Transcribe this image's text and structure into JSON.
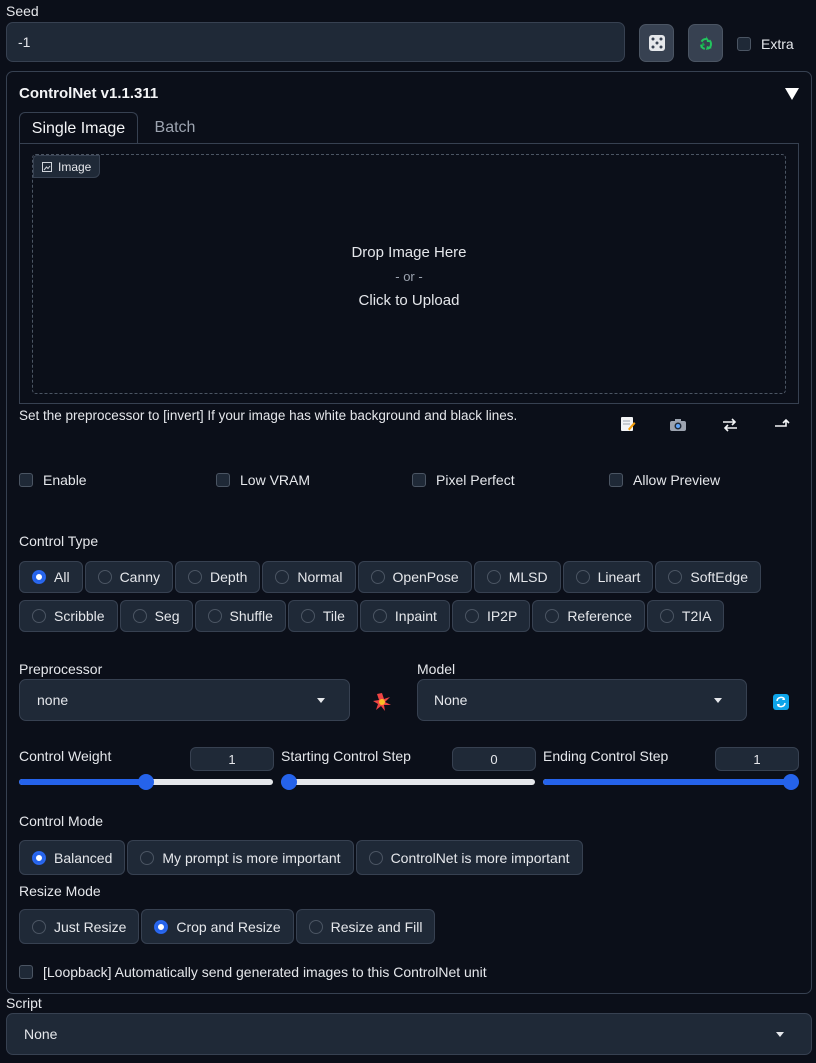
{
  "seed": {
    "label": "Seed",
    "value": "-1",
    "extra_label": "Extra"
  },
  "controlnet": {
    "title": "ControlNet v1.1.311",
    "tabs": [
      {
        "label": "Single Image",
        "active": true
      },
      {
        "label": "Batch",
        "active": false
      }
    ],
    "image_tag": "Image",
    "drop_text": "Drop Image Here",
    "or_text": "- or -",
    "upload_text": "Click to Upload",
    "hint": "Set the preprocessor to [invert] If your image has white background and black lines.",
    "checkboxes": [
      "Enable",
      "Low VRAM",
      "Pixel Perfect",
      "Allow Preview"
    ],
    "control_type": {
      "label": "Control Type",
      "selected": "All",
      "row1": [
        "All",
        "Canny",
        "Depth",
        "Normal",
        "OpenPose",
        "MLSD",
        "Lineart",
        "SoftEdge"
      ],
      "row2": [
        "Scribble",
        "Seg",
        "Shuffle",
        "Tile",
        "Inpaint",
        "IP2P",
        "Reference",
        "T2IA"
      ]
    },
    "preprocessor": {
      "label": "Preprocessor",
      "value": "none"
    },
    "model": {
      "label": "Model",
      "value": "None"
    },
    "control_weight": {
      "label": "Control Weight",
      "value": "1",
      "fraction": 0.5
    },
    "starting_step": {
      "label": "Starting Control Step",
      "value": "0",
      "fraction": 0.0
    },
    "ending_step": {
      "label": "Ending Control Step",
      "value": "1",
      "fraction": 1.0
    },
    "control_mode": {
      "label": "Control Mode",
      "selected": "Balanced",
      "options": [
        "Balanced",
        "My prompt is more important",
        "ControlNet is more important"
      ]
    },
    "resize_mode": {
      "label": "Resize Mode",
      "selected": "Crop and Resize",
      "options": [
        "Just Resize",
        "Crop and Resize",
        "Resize and Fill"
      ]
    },
    "loopback_label": "[Loopback] Automatically send generated images to this ControlNet unit"
  },
  "script": {
    "label": "Script",
    "value": "None"
  },
  "colors": {
    "background": "#0b0f19",
    "accent": "#2563eb",
    "field": "#1f2937",
    "border": "#374151"
  },
  "icons": {
    "dice": "dice-icon",
    "recycle": "recycle-icon",
    "edit": "edit-icon",
    "camera": "camera-icon",
    "swap": "swap-icon",
    "send": "send-dimensions-icon",
    "explode": "explode-icon",
    "refresh": "refresh-icon",
    "collapse": "collapse-triangle-icon"
  }
}
